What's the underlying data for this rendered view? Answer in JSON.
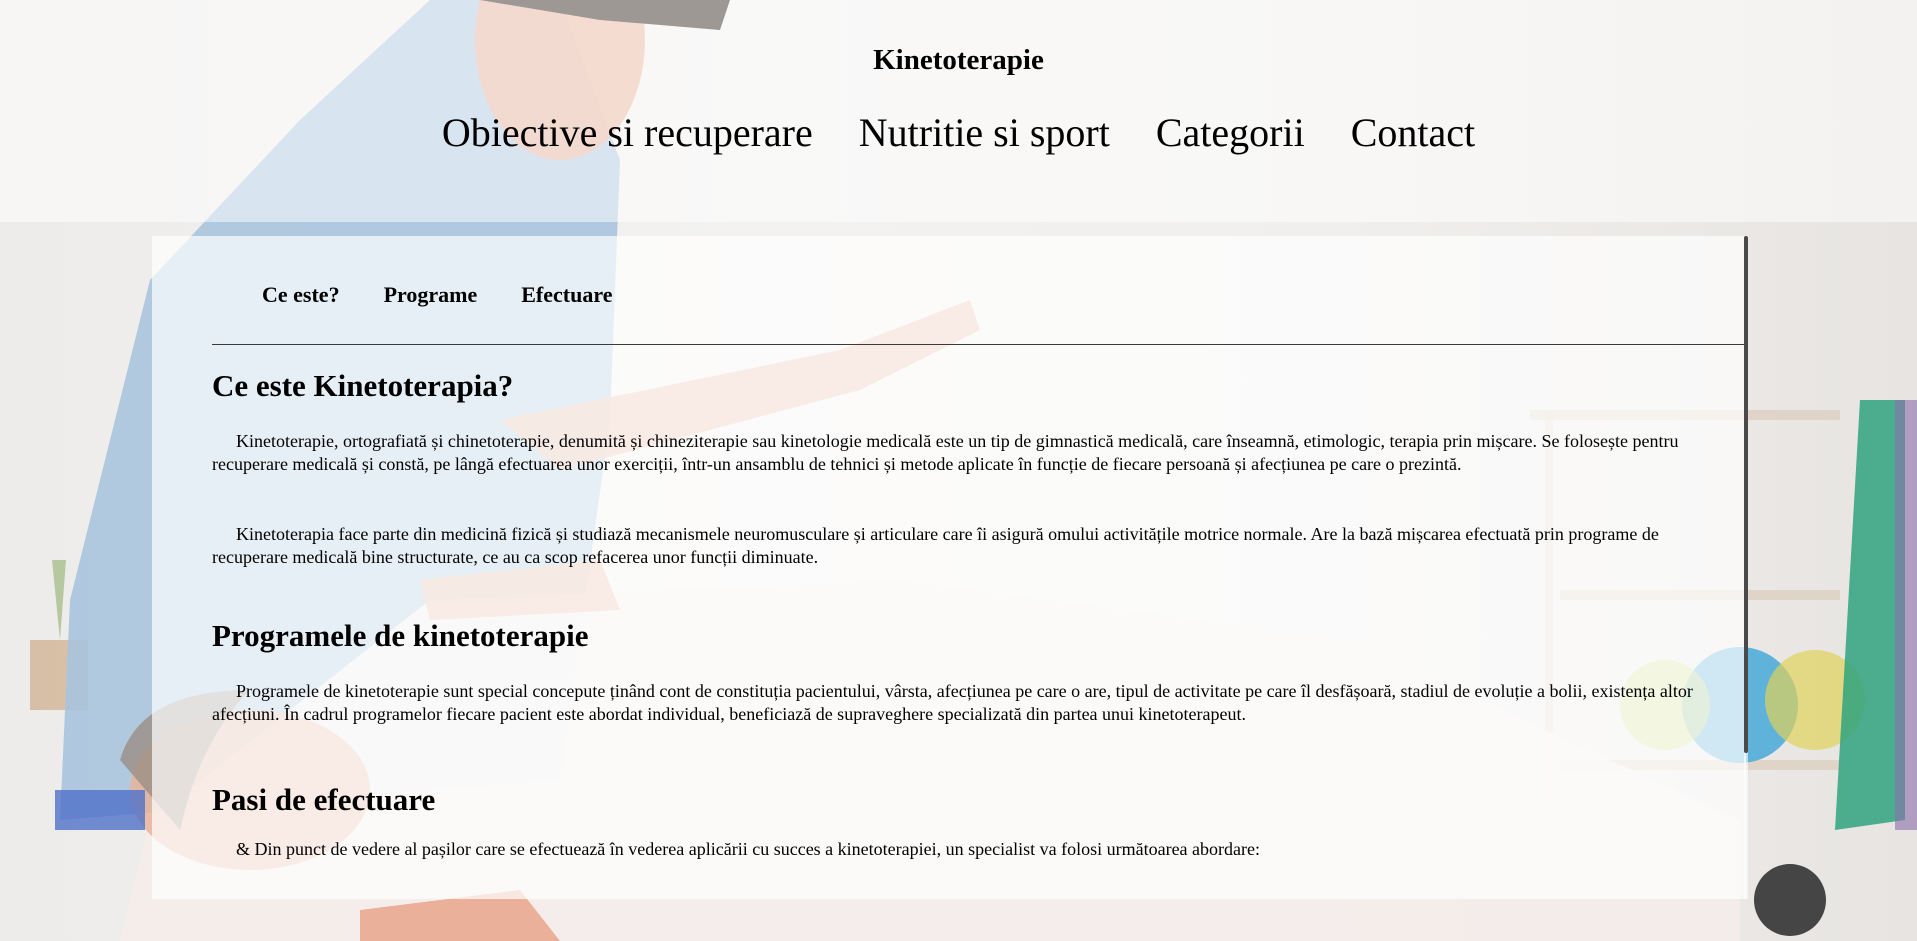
{
  "site": {
    "title": "Kinetoterapie"
  },
  "main_nav": [
    {
      "label": "Obiective si recuperare"
    },
    {
      "label": "Nutritie si sport"
    },
    {
      "label": "Categorii"
    },
    {
      "label": "Contact"
    }
  ],
  "sub_nav": [
    {
      "label": "Ce este?"
    },
    {
      "label": "Programe"
    },
    {
      "label": "Efectuare"
    }
  ],
  "sections": {
    "what": {
      "heading": "Ce este Kinetoterapia?",
      "paragraphs": [
        "Kinetoterapie, ortografiată și chinetoterapie, denumită și chineziterapie sau kinetologie medicală este un tip de gimnastică medicală, care înseamnă, etimologic, terapia prin mișcare. Se folosește pentru recuperare medicală și constă, pe lângă efectuarea unor exerciții, într-un ansamblu de tehnici și metode aplicate în funcție de fiecare persoană și afecțiunea pe care o prezintă.",
        "Kinetoterapia face parte din medicină fizică și studiază mecanismele neuromusculare și articulare care îi asigură omului activitățile motrice normale. Are la bază mișcarea efectuată prin programe de recuperare medicală bine structurate, ce au ca scop refacerea unor funcții diminuate."
      ]
    },
    "programs": {
      "heading": "Programele de kinetoterapie",
      "paragraphs": [
        "Programele de kinetoterapie sunt special concepute ținând cont de constituția pacientului, vârsta, afecțiunea pe care o are, tipul de activitate pe care îl desfășoară, stadiul de evoluție a bolii, existența altor afecțiuni. În cadrul programelor fiecare pacient este abordat individual, beneficiază de supraveghere specializată din partea unui kinetoterapeut."
      ]
    },
    "steps": {
      "heading": "Pasi de efectuare",
      "paragraphs": [
        "& Din punct de vedere al pașilor care se efectuează în vederea aplicării cu succes a kinetoterapiei, un specialist va folosi următoarea abordare:"
      ]
    }
  },
  "colors": {
    "shirt": "#a9c4de",
    "skin": "#e8b49c",
    "bed": "#f4ecea",
    "green_towel": "#2fa37e",
    "ball_blue": "#46a9d8",
    "ball_yellow": "#e0d25a",
    "scrollbar_thumb": "#4a4a4a"
  }
}
